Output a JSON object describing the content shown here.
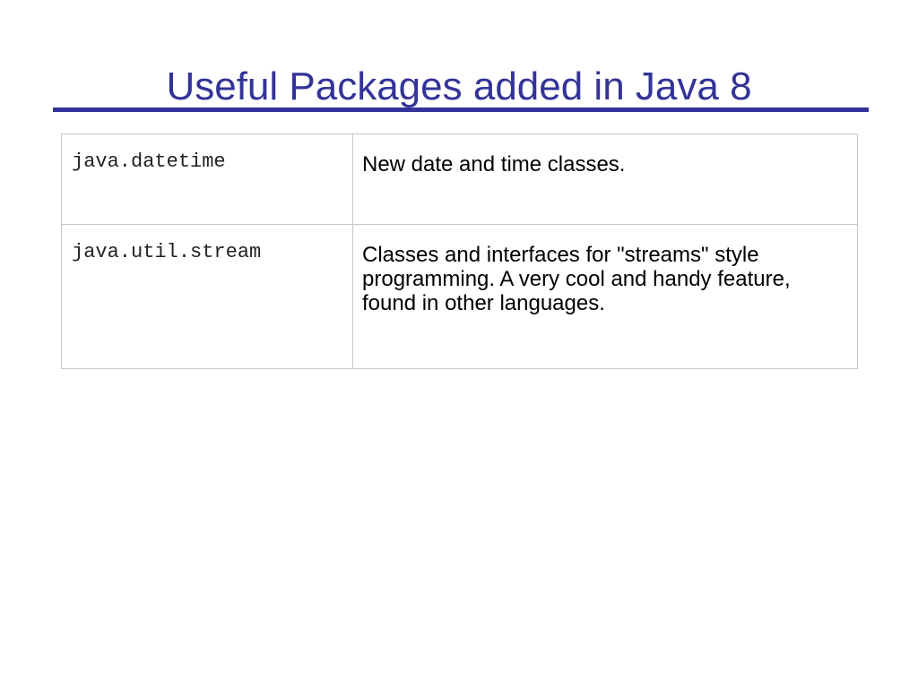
{
  "slide": {
    "title": "Useful Packages added in Java 8"
  },
  "packages": [
    {
      "name": "java.datetime",
      "description": "New date and time classes."
    },
    {
      "name": "java.util.stream",
      "description": "Classes and interfaces for \"streams\" style programming.  A very cool and handy feature, found in other languages."
    }
  ],
  "colors": {
    "title": "#333399",
    "rule": "#333399",
    "table_border": "#c8c8c8"
  }
}
